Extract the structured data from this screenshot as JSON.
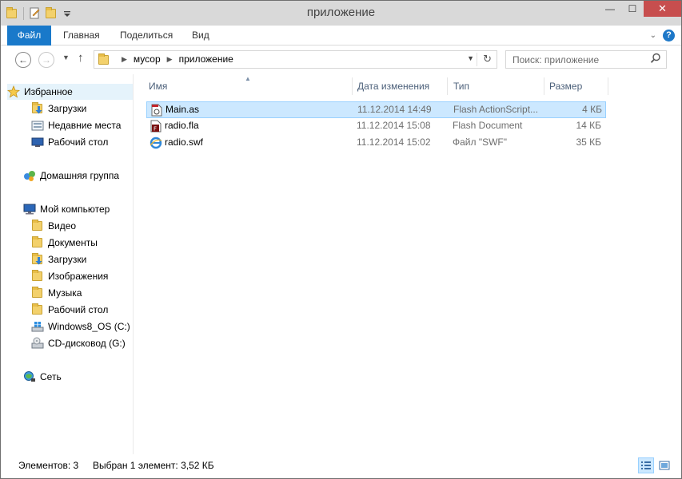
{
  "window": {
    "title": "приложение",
    "minimize_glyph": "—",
    "maximize_glyph": "☐",
    "close_glyph": "✕"
  },
  "ribbon": {
    "tabs": [
      {
        "label": "Файл",
        "active": true
      },
      {
        "label": "Главная"
      },
      {
        "label": "Поделиться"
      },
      {
        "label": "Вид"
      }
    ],
    "help_label": "?"
  },
  "navigation": {
    "back_glyph": "←",
    "forward_glyph": "→",
    "up_glyph": "↑",
    "breadcrumb": [
      "мусор",
      "приложение"
    ],
    "search_placeholder": "Поиск: приложение"
  },
  "sidebar": {
    "favorites": {
      "label": "Избранное",
      "icon": "star-icon"
    },
    "favorites_items": [
      {
        "label": "Загрузки",
        "icon": "downloads-folder-icon"
      },
      {
        "label": "Недавние места",
        "icon": "recent-places-icon"
      },
      {
        "label": "Рабочий стол",
        "icon": "desktop-icon"
      }
    ],
    "homegroup": {
      "label": "Домашняя группа",
      "icon": "homegroup-icon"
    },
    "computer": {
      "label": "Мой компьютер",
      "icon": "computer-icon"
    },
    "computer_items": [
      {
        "label": "Видео",
        "icon": "video-folder-icon"
      },
      {
        "label": "Документы",
        "icon": "documents-folder-icon"
      },
      {
        "label": "Загрузки",
        "icon": "downloads-folder-icon"
      },
      {
        "label": "Изображения",
        "icon": "pictures-folder-icon"
      },
      {
        "label": "Музыка",
        "icon": "music-folder-icon"
      },
      {
        "label": "Рабочий стол",
        "icon": "desktop-folder-icon"
      },
      {
        "label": "Windows8_OS (C:)",
        "icon": "windows-drive-icon"
      },
      {
        "label": "CD-дисковод (G:)",
        "icon": "cd-drive-icon"
      }
    ],
    "network": {
      "label": "Сеть",
      "icon": "network-icon"
    }
  },
  "file_list": {
    "columns": [
      "Имя",
      "Дата изменения",
      "Тип",
      "Размер"
    ],
    "rows": [
      {
        "name": "Main.as",
        "date": "11.12.2014 14:49",
        "type": "Flash ActionScript...",
        "size": "4 КБ",
        "icon": "actionscript-file-icon",
        "selected": true
      },
      {
        "name": "radio.fla",
        "date": "11.12.2014 15:08",
        "type": "Flash Document",
        "size": "14 КБ",
        "icon": "fla-file-icon"
      },
      {
        "name": "radio.swf",
        "date": "11.12.2014 15:02",
        "type": "Файл \"SWF\"",
        "size": "35 КБ",
        "icon": "swf-file-icon"
      }
    ]
  },
  "status": {
    "items_count": "Элементов: 3",
    "selection": "Выбран 1 элемент: 3,52 КБ"
  },
  "colors": {
    "accent": "#1979ca",
    "selection": "#cce8ff",
    "selection_border": "#99d1ff",
    "close": "#c74e4e"
  }
}
